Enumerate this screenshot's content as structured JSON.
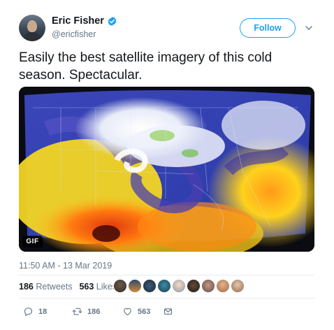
{
  "author": {
    "display_name": "Eric Fisher",
    "handle": "@ericfisher",
    "verified": true,
    "verified_color": "#1da1f2"
  },
  "follow_button": {
    "label": "Follow"
  },
  "tweet": {
    "text": "Easily the best satellite imagery of this cold season. Spectacular.",
    "media_badge": "GIF",
    "timestamp": "11:50 AM - 13 Mar 2019"
  },
  "stats": {
    "retweets_count": "186",
    "retweets_label": "Retweets",
    "likes_count": "563",
    "likes_label": "Likes"
  },
  "actions": {
    "reply_count": "18",
    "retweet_count": "186",
    "like_count": "563"
  },
  "icons": {
    "verified": "verified-badge-icon",
    "more": "chevron-down-icon",
    "reply": "reply-icon",
    "retweet": "retweet-icon",
    "like": "heart-icon",
    "message": "envelope-icon"
  },
  "colors": {
    "accent": "#1da1f2",
    "muted": "#657786",
    "text": "#14171a"
  }
}
